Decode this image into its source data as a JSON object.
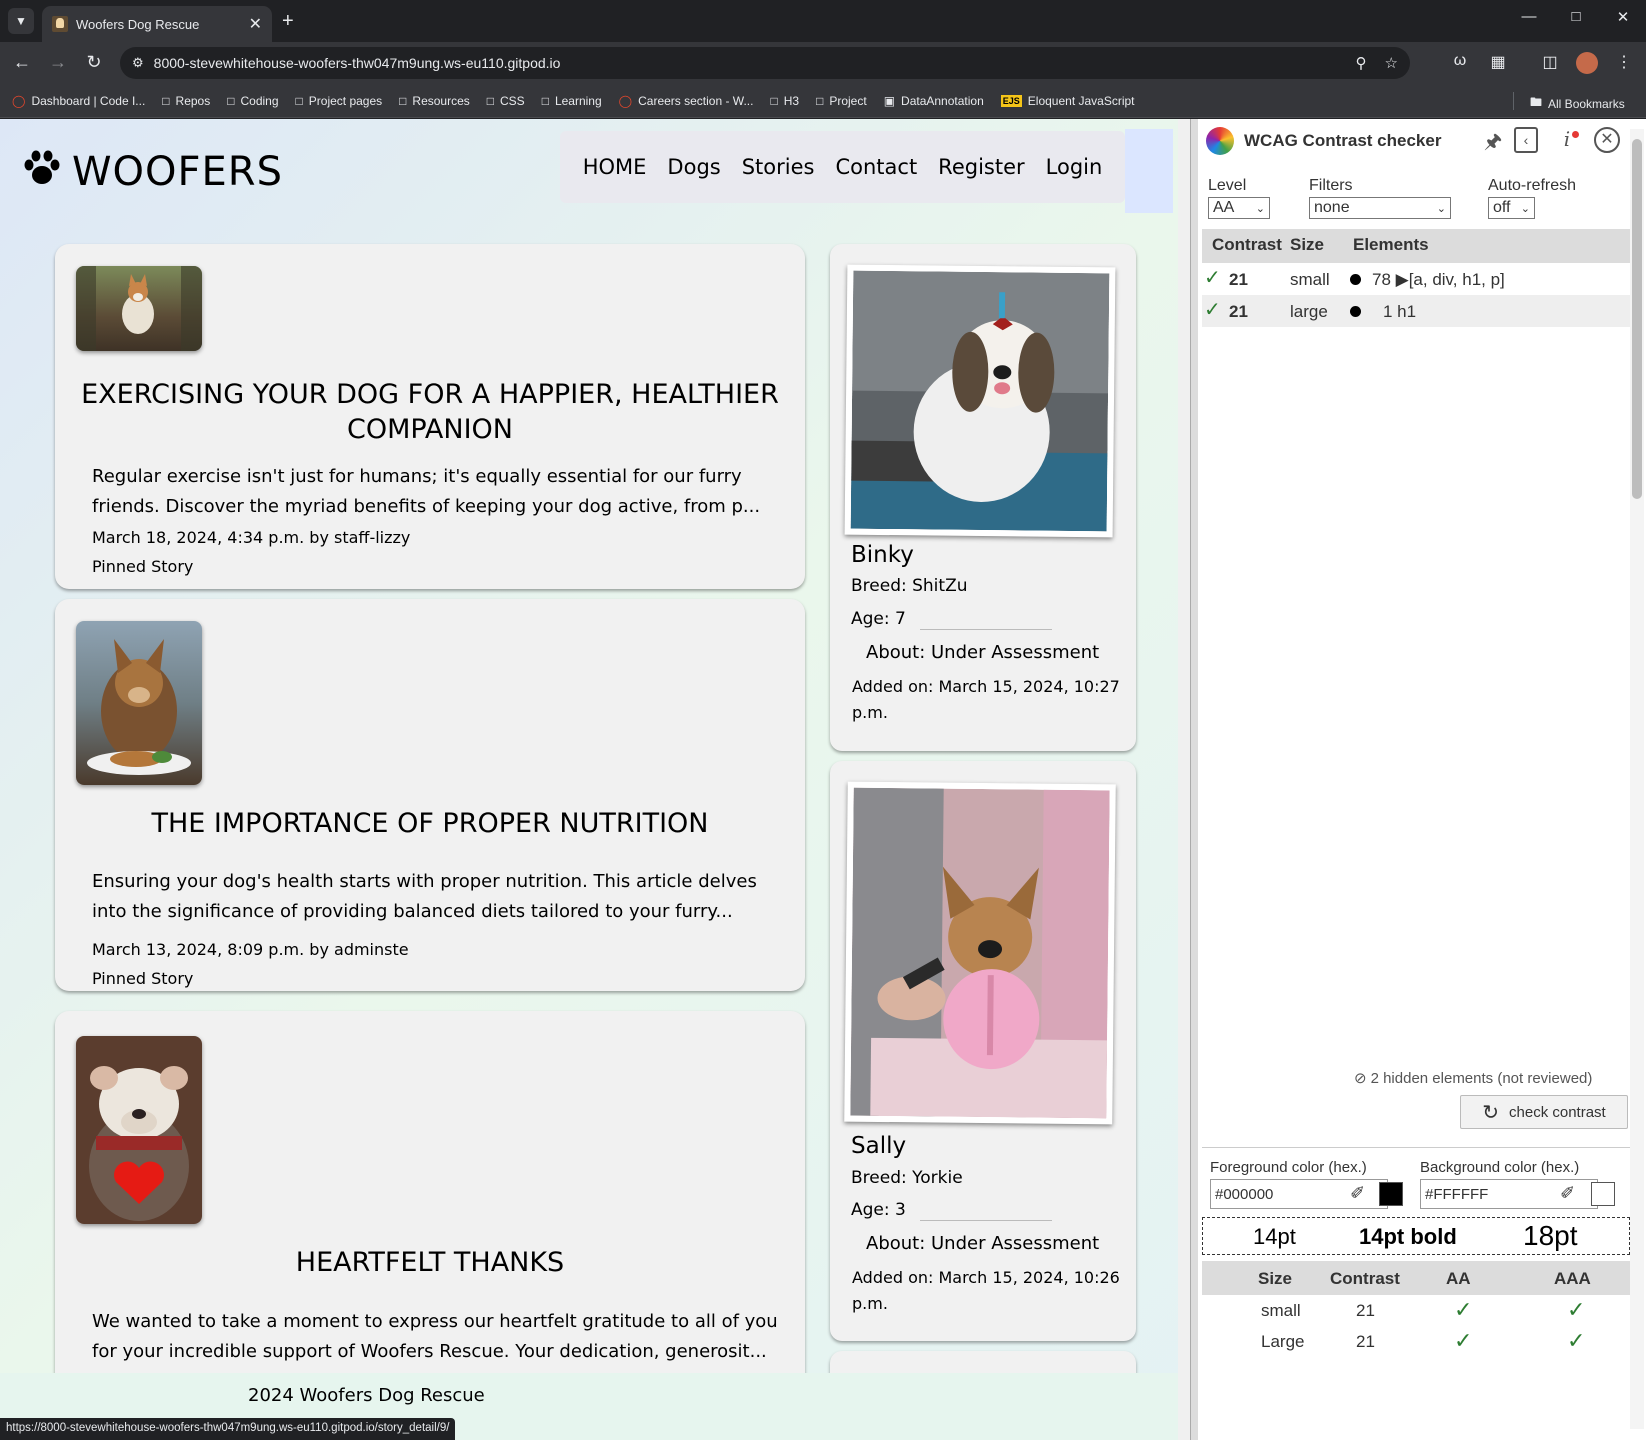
{
  "browser": {
    "tab_title": "Woofers Dog Rescue",
    "url": "8000-stevewhitehouse-woofers-thw047m9ung.ws-eu110.gitpod.io",
    "bookmarks": [
      {
        "label": "Dashboard | Code I...",
        "icon": "red-circle-icon"
      },
      {
        "label": "Repos",
        "icon": "folder-icon"
      },
      {
        "label": "Coding",
        "icon": "folder-icon"
      },
      {
        "label": "Project pages",
        "icon": "folder-icon"
      },
      {
        "label": "Resources",
        "icon": "folder-icon"
      },
      {
        "label": "CSS",
        "icon": "folder-icon"
      },
      {
        "label": "Learning",
        "icon": "folder-icon"
      },
      {
        "label": "Careers section - W...",
        "icon": "red-circle-icon"
      },
      {
        "label": "H3",
        "icon": "folder-icon"
      },
      {
        "label": "Project",
        "icon": "folder-icon"
      },
      {
        "label": "DataAnnotation",
        "icon": "data-icon"
      },
      {
        "label": "Eloquent JavaScript",
        "icon": "ejs-icon"
      }
    ],
    "all_bookmarks": "All Bookmarks",
    "status_url": "https://8000-stevewhitehouse-woofers-thw047m9ung.ws-eu110.gitpod.io/story_detail/9/"
  },
  "site": {
    "logo": "WOOFERS",
    "nav": [
      "HOME",
      "Dogs",
      "Stories",
      "Contact",
      "Register",
      "Login"
    ],
    "footer": "2024 Woofers Dog Rescue"
  },
  "stories": [
    {
      "title": "EXERCISING YOUR DOG FOR A HAPPIER, HEALTHIER COMPANION",
      "excerpt": "Regular exercise isn't just for humans; it's equally essential for our furry friends. Discover the myriad benefits of keeping your dog active, from p...",
      "meta": "March 18, 2024, 4:34 p.m. by staff-lizzy",
      "pinned": "Pinned Story"
    },
    {
      "title": "THE IMPORTANCE OF PROPER NUTRITION",
      "excerpt": "Ensuring your dog's health starts with proper nutrition. This article delves into the significance of providing balanced diets tailored to your furry...",
      "meta": "March 13, 2024, 8:09 p.m. by adminste",
      "pinned": "Pinned Story"
    },
    {
      "title": "HEARTFELT THANKS",
      "excerpt": "We wanted to take a moment to express our heartfelt gratitude to all of you for your incredible support of Woofers Rescue. Your dedication, generosit...",
      "meta": "",
      "pinned": ""
    }
  ],
  "dogs": [
    {
      "name": "Binky",
      "breed": "Breed: ShitZu",
      "age": "Age: 7",
      "about": "About: Under Assessment",
      "added": "Added on: March 15, 2024, 10:27 p.m."
    },
    {
      "name": "Sally",
      "breed": "Breed: Yorkie",
      "age": "Age: 3",
      "about": "About: Under Assessment",
      "added": "Added on: March 15, 2024, 10:26 p.m."
    }
  ],
  "wcag": {
    "title": "WCAG Contrast checker",
    "level_label": "Level",
    "level_value": "AA",
    "filters_label": "Filters",
    "filters_value": "none",
    "autorefresh_label": "Auto-refresh",
    "autorefresh_value": "off",
    "headers": [
      "Contrast",
      "Size",
      "Elements"
    ],
    "rows": [
      {
        "contrast": "21",
        "size": "small",
        "elements": "78 ▶[a, div, h1, p]"
      },
      {
        "contrast": "21",
        "size": "large",
        "elements": "1 h1"
      }
    ],
    "hidden_note": "2 hidden elements (not reviewed)",
    "check_button": "check contrast",
    "fg_label": "Foreground color (hex.)",
    "fg_value": "#000000",
    "bg_label": "Background color (hex.)",
    "bg_value": "#FFFFFF",
    "samples": [
      "14pt",
      "14pt bold",
      "18pt"
    ],
    "result_headers": [
      "Size",
      "Contrast",
      "AA",
      "AAA"
    ],
    "results": [
      {
        "size": "small",
        "contrast": "21"
      },
      {
        "size": "Large",
        "contrast": "21"
      }
    ]
  }
}
